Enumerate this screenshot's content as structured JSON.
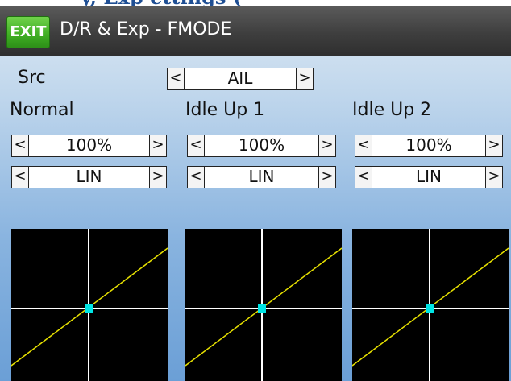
{
  "title_bar": {
    "exit_label": "EXIT",
    "title": "D/R & Exp - FMODE"
  },
  "source": {
    "label": "Src",
    "value": "AIL"
  },
  "modes": [
    {
      "name": "Normal",
      "rate": "100%",
      "curve_type": "LIN"
    },
    {
      "name": "Idle Up 1",
      "rate": "100%",
      "curve_type": "LIN"
    },
    {
      "name": "Idle Up 2",
      "rate": "100%",
      "curve_type": "LIN"
    }
  ],
  "colors": {
    "curve_line": "#e6e000",
    "center_point": "#00e5e5",
    "graph_bg": "#000000",
    "grid": "#ffffff"
  }
}
